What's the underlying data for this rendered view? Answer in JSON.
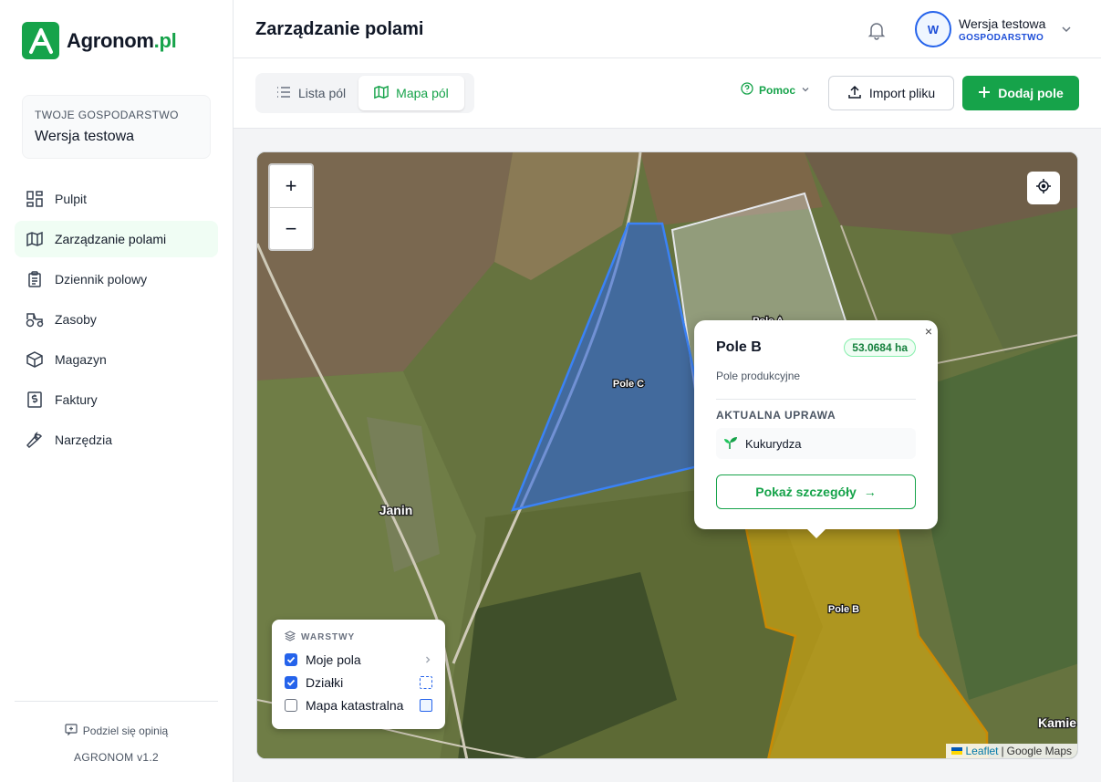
{
  "app": {
    "logo_name": "Agronom",
    "logo_tld": ".pl"
  },
  "farm": {
    "caption": "TWOJE GOSPODARSTWO",
    "name": "Wersja testowa"
  },
  "nav": {
    "items": [
      {
        "label": "Pulpit",
        "icon": "dashboard-icon"
      },
      {
        "label": "Zarządzanie polami",
        "icon": "map-icon",
        "active": true
      },
      {
        "label": "Dziennik polowy",
        "icon": "clipboard-icon"
      },
      {
        "label": "Zasoby",
        "icon": "tractor-icon"
      },
      {
        "label": "Magazyn",
        "icon": "box-icon"
      },
      {
        "label": "Faktury",
        "icon": "invoice-icon"
      },
      {
        "label": "Narzędzia",
        "icon": "wrench-icon"
      }
    ]
  },
  "footer": {
    "feedback": "Podziel się opinią",
    "version": "AGRONOM v1.2"
  },
  "header": {
    "title": "Zarządzanie polami",
    "user_initial": "W",
    "user_name": "Wersja testowa",
    "user_role": "GOSPODARSTWO"
  },
  "toolbar": {
    "list_label": "Lista pól",
    "map_label": "Mapa pól",
    "help_label": "Pomoc",
    "import_label": "Import pliku",
    "add_label": "Dodaj pole"
  },
  "map": {
    "zoom_in": "+",
    "zoom_out": "−",
    "field_labels": [
      "Pole C",
      "Pole A",
      "Pole B"
    ],
    "town_labels": [
      "Janin",
      "Kamie"
    ],
    "attribution_leaflet": "Leaflet",
    "attribution_sep": "|",
    "attribution_maps": "Google Maps",
    "field_colors": {
      "pole_c": "#2563eb",
      "pole_b": "#eab308",
      "pole_a": "#e5e7eb"
    }
  },
  "layers": {
    "title": "WARSTWY",
    "items": [
      {
        "label": "Moje pola",
        "checked": true
      },
      {
        "label": "Działki",
        "checked": true
      },
      {
        "label": "Mapa katastralna",
        "checked": false
      }
    ]
  },
  "popup": {
    "close": "×",
    "title": "Pole B",
    "area": "53.0684 ha",
    "type": "Pole produkcyjne",
    "crop_caption": "AKTUALNA UPRAWA",
    "crop": "Kukurydza",
    "details_label": "Pokaż szczegóły",
    "details_arrow": "→"
  }
}
